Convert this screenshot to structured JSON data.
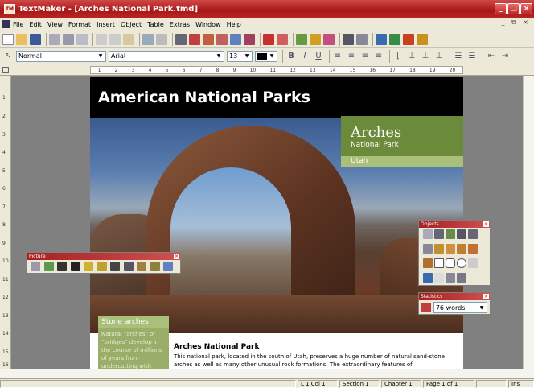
{
  "window": {
    "title": "TextMaker - [Arches National Park.tmd]",
    "logo": "TM"
  },
  "menu": [
    "File",
    "Edit",
    "View",
    "Format",
    "Insert",
    "Object",
    "Table",
    "Extras",
    "Window",
    "Help"
  ],
  "format_bar": {
    "style": "Normal",
    "font": "Arial",
    "size": "13"
  },
  "ruler": {
    "ticks": [
      "1",
      "2",
      "3",
      "4",
      "5",
      "6",
      "7",
      "8",
      "9",
      "10",
      "11",
      "12",
      "13",
      "14",
      "15",
      "16",
      "17",
      "18",
      "19",
      "20"
    ]
  },
  "vruler": [
    "1",
    "2",
    "3",
    "4",
    "5",
    "6",
    "7",
    "8",
    "9",
    "10",
    "11",
    "12",
    "13",
    "14",
    "15",
    "16"
  ],
  "document": {
    "heading": "American National Parks",
    "green_box": {
      "title": "Arches",
      "subtitle": "National Park",
      "state": "Utah"
    },
    "sidebox": {
      "title": "Stone arches",
      "text": "Natural \"arches\" or \"bridges\" develop in the course of millions of years from undercutting with"
    },
    "article_title": "Arches National Park",
    "article_text": "This national park, located in the south of Utah, preserves a huge number of natural sand-stone arches as well as many other unusual rock formations. The extraordinary features of"
  },
  "panels": {
    "picture": "Picture",
    "objects": "Objects",
    "statistics": "Statistics",
    "word_count": "76 words"
  },
  "status": {
    "position": "L 1 Col 1",
    "section": "Section 1",
    "chapter": "Chapter 1",
    "page": "Page 1 of 1",
    "mode": "Ins"
  },
  "colors": {
    "title_bar": "#a81818",
    "green": "#6b8a3a",
    "light_green": "#a9bf7a"
  }
}
